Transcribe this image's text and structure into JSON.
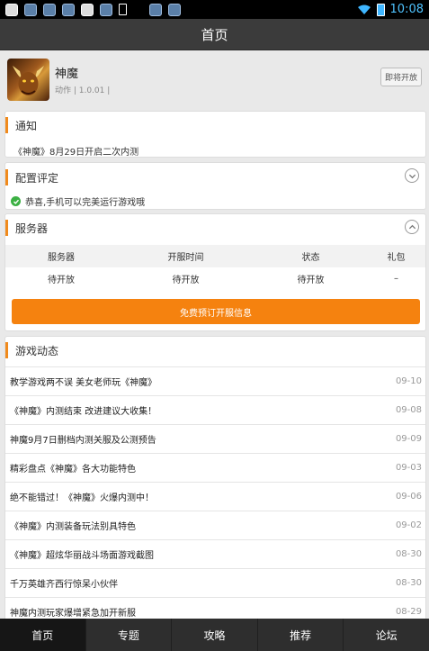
{
  "status_bar": {
    "time": "10:08",
    "icons": [
      "notification-icon",
      "notification-icon",
      "notification-icon",
      "notification-icon",
      "notification-icon",
      "notification-icon",
      "download-icon",
      "notification-icon",
      "notification-icon",
      "wifi-icon",
      "battery-icon"
    ]
  },
  "titlebar": {
    "title": "首页"
  },
  "app": {
    "name": "神魔",
    "meta": "动作  |  1.0.01  |",
    "button_label": "即将开放"
  },
  "notice": {
    "title": "通知",
    "text": "《神魔》8月29日开启二次内测"
  },
  "config": {
    "title": "配置评定",
    "result": "恭喜,手机可以完美运行游戏哦"
  },
  "server": {
    "title": "服务器",
    "columns": [
      "服务器",
      "开服时间",
      "状态",
      "礼包"
    ],
    "rows": [
      [
        "待开放",
        "待开放",
        "待开放",
        "–"
      ]
    ],
    "reserve_button": "免费预订开服信息"
  },
  "news": {
    "title": "游戏动态",
    "items": [
      {
        "title": "教学游戏两不误 美女老师玩《神魔》",
        "date": "09-10"
      },
      {
        "title": "《神魔》内测结束 改进建议大收集！",
        "date": "09-08"
      },
      {
        "title": "神魔9月7日删档内测关服及公测预告",
        "date": "09-09"
      },
      {
        "title": "精彩盘点《神魔》各大功能特色",
        "date": "09-03"
      },
      {
        "title": "绝不能错过！《神魔》火爆内测中！",
        "date": "09-06"
      },
      {
        "title": "《神魔》内测装备玩法别具特色",
        "date": "09-02"
      },
      {
        "title": "《神魔》超炫华丽战斗场面游戏截图",
        "date": "08-30"
      },
      {
        "title": "千万英雄齐西行惊呆小伙伴",
        "date": "08-30"
      },
      {
        "title": "神魔内测玩家爆增紧急加开新服",
        "date": "08-29"
      }
    ]
  },
  "bottom_nav": {
    "items": [
      {
        "label": "首页",
        "active": true
      },
      {
        "label": "专题",
        "active": false
      },
      {
        "label": "攻略",
        "active": false
      },
      {
        "label": "推荐",
        "active": false
      },
      {
        "label": "论坛",
        "active": false
      }
    ]
  },
  "colors": {
    "accent": "#f5820f",
    "titlebar": "#3b3b3b",
    "status_ok": "#3cb043"
  }
}
